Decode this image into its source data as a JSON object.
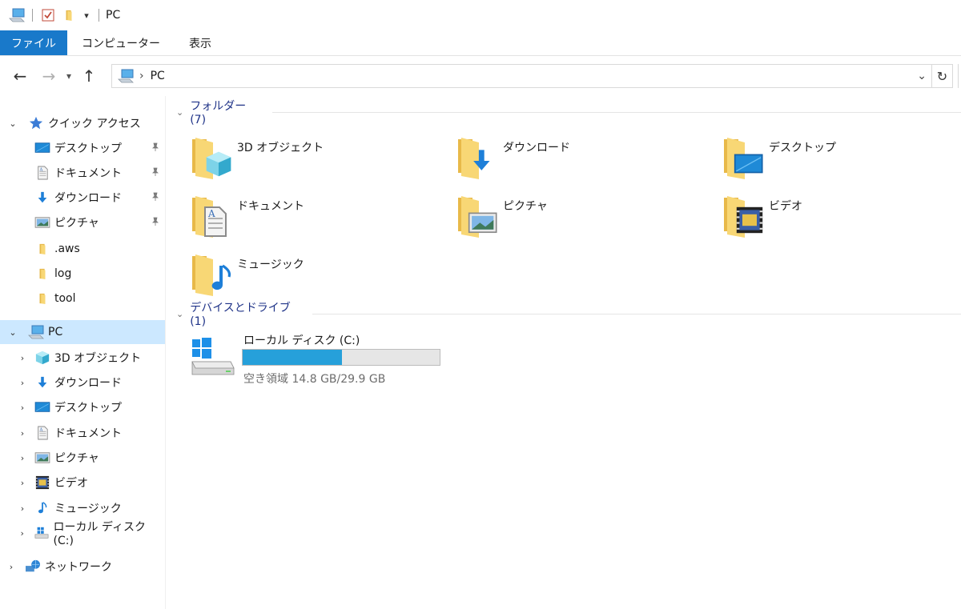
{
  "window": {
    "title": "PC"
  },
  "ribbon": {
    "tabs": [
      {
        "label": "ファイル",
        "active": true
      },
      {
        "label": "コンピューター"
      },
      {
        "label": "表示"
      }
    ]
  },
  "address": {
    "path": "PC",
    "separator": "›"
  },
  "sidebar": {
    "quick_access": {
      "label": "クイック アクセス",
      "items": [
        {
          "label": "デスクトップ",
          "pinned": true
        },
        {
          "label": "ドキュメント",
          "pinned": true
        },
        {
          "label": "ダウンロード",
          "pinned": true
        },
        {
          "label": "ピクチャ",
          "pinned": true
        },
        {
          "label": ".aws"
        },
        {
          "label": "log"
        },
        {
          "label": "tool"
        }
      ]
    },
    "pc": {
      "label": "PC",
      "selected": true,
      "items": [
        {
          "label": "3D オブジェクト"
        },
        {
          "label": "ダウンロード"
        },
        {
          "label": "デスクトップ"
        },
        {
          "label": "ドキュメント"
        },
        {
          "label": "ピクチャ"
        },
        {
          "label": "ビデオ"
        },
        {
          "label": "ミュージック"
        },
        {
          "label": "ローカル ディスク (C:)"
        }
      ]
    },
    "network": {
      "label": "ネットワーク"
    }
  },
  "content": {
    "folders_group": {
      "title": "フォルダー (7)"
    },
    "folders": [
      {
        "label": "3D オブジェクト"
      },
      {
        "label": "ダウンロード"
      },
      {
        "label": "デスクトップ"
      },
      {
        "label": "ドキュメント"
      },
      {
        "label": "ピクチャ"
      },
      {
        "label": "ビデオ"
      },
      {
        "label": "ミュージック"
      }
    ],
    "drives_group": {
      "title": "デバイスとドライブ (1)"
    },
    "drive": {
      "name": "ローカル ディスク (C:)",
      "free_text": "空き領域 14.8 GB/29.9 GB",
      "used_fraction": 0.505
    }
  },
  "colors": {
    "accent": "#1979ca",
    "selection": "#cce8ff",
    "folder": "#f8d775",
    "drive_bar": "#26a0da",
    "group_header": "#1e3287"
  }
}
